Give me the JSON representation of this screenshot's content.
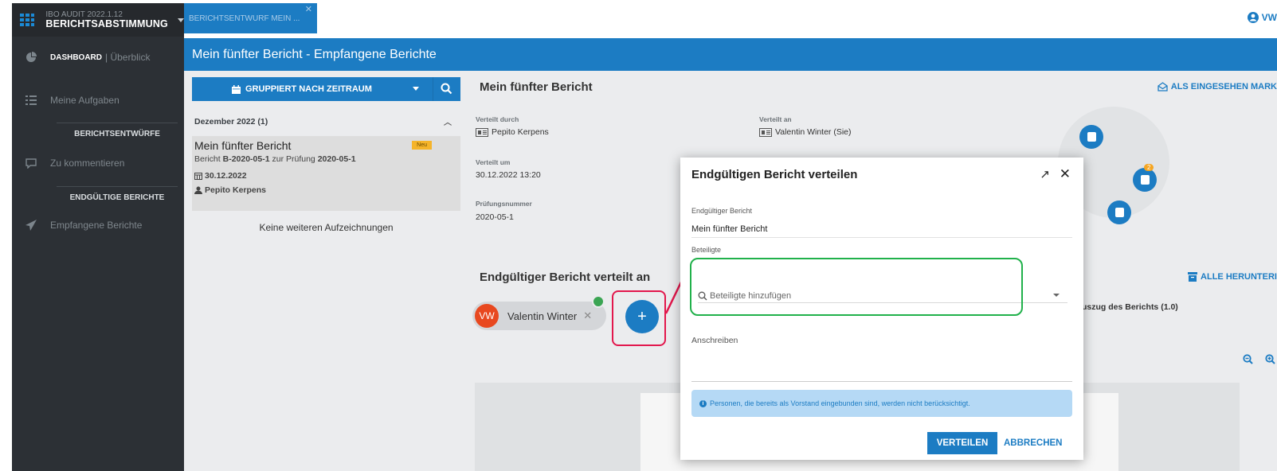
{
  "app": {
    "version": "IBO AUDIT 2022.1.12",
    "name": "BERICHTSABSTIMMUNG"
  },
  "sidebar": {
    "dashboard_bold": "DASHBOARD",
    "dashboard_sub": "| Überblick",
    "my_tasks": "Meine Aufgaben",
    "section_drafts": "BERICHTSENTWÜRFE",
    "to_comment": "Zu kommentieren",
    "section_final": "ENDGÜLTIGE BERICHTE",
    "received": "Empfangene Berichte"
  },
  "tabs": {
    "doc_tab": "BERICHTSENTWURF MEIN ...",
    "user": "VW"
  },
  "header": {
    "title": "Mein fünfter Bericht - Empfangene Berichte"
  },
  "list": {
    "group_button": "GRUPPIERT NACH ZEITRAUM",
    "month": "Dezember 2022 (1)",
    "item_title": "Mein fünfter Bericht",
    "item_badge": "Neu",
    "item_sub_a": "Bericht",
    "item_sub_b": "B-2020-05-1",
    "item_sub_c": "zur Prüfung",
    "item_sub_d": "2020-05-1",
    "item_date": "30.12.2022",
    "item_person": "Pepito Kerpens",
    "no_more": "Keine weiteren Aufzeichnungen"
  },
  "detail": {
    "title": "Mein fünfter Bericht",
    "mark_seen": "ALS EINGESEHEN MARK",
    "distributed_by_label": "Verteilt durch",
    "distributed_by": "Pepito Kerpens",
    "distributed_to_label": "Verteilt an",
    "distributed_to": "Valentin Winter (Sie)",
    "distributed_on_label": "Verteilt um",
    "distributed_on": "30.12.2022 13:20",
    "audit_no_label": "Prüfungsnummer",
    "audit_no": "2020-05-1",
    "workflow_badge": "2",
    "section_title": "Endgültiger Bericht verteilt an",
    "chip_initials": "VW",
    "chip_name": "Valentin Winter",
    "add_symbol": "+",
    "download_all": "ALLE HERUNTERI",
    "excerpt": "uszug des Berichts (1.0)"
  },
  "modal": {
    "title": "Endgültigen Bericht verteilen",
    "report_label": "Endgültiger Bericht",
    "report_value": "Mein fünfter Bericht",
    "participants_label": "Beteiligte",
    "participants_placeholder": "Beteiligte hinzufügen",
    "cover_letter_label": "Anschreiben",
    "info_text": "Personen, die bereits als Vorstand eingebunden sind, werden nicht berücksichtigt.",
    "primary_button": "VERTEILEN",
    "secondary_button": "ABBRECHEN"
  },
  "colors": {
    "brand_blue": "#1c7cc3",
    "sidebar": "#2c3035",
    "badge": "#f5b42a",
    "highlight_red": "#e2174c",
    "highlight_green": "#21b14b"
  }
}
